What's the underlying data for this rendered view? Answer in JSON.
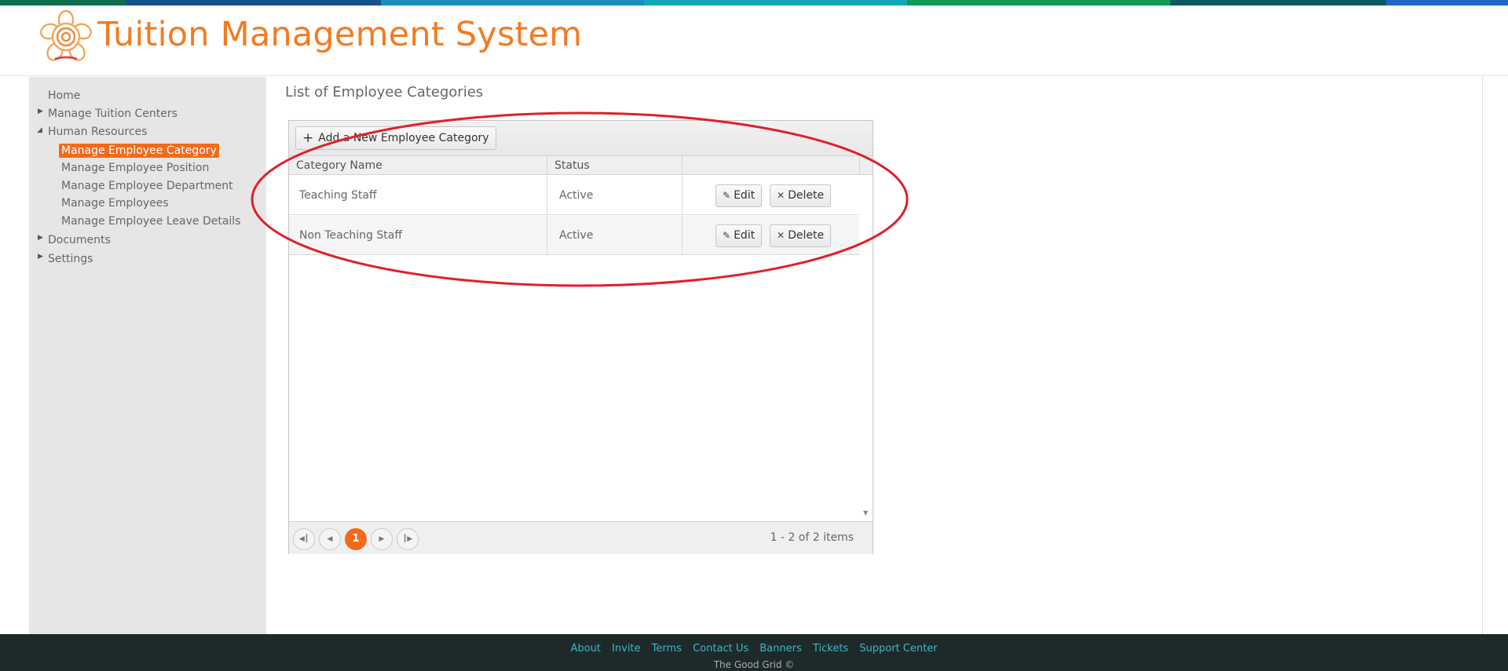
{
  "stripe_colors": [
    "#0c6e4f",
    "#15518f",
    "#1a8ebf",
    "#12a8b8",
    "#0f9a58",
    "#0c5960",
    "#1d69c0"
  ],
  "header": {
    "title": "Tuition Management System",
    "logo_icon": "flower-logo-icon"
  },
  "sidebar": {
    "items": [
      {
        "label": "Home"
      },
      {
        "label": "Manage Tuition Centers"
      },
      {
        "label": "Human Resources"
      },
      {
        "label": "Manage Employee Category"
      },
      {
        "label": "Manage Employee Position"
      },
      {
        "label": "Manage Employee Department"
      },
      {
        "label": "Manage Employees"
      },
      {
        "label": "Manage Employee Leave Details"
      },
      {
        "label": "Documents"
      },
      {
        "label": "Settings"
      }
    ]
  },
  "main": {
    "title": "List of Employee Categories",
    "add_button": "Add a New Employee Category",
    "columns": [
      "Category Name",
      "Status",
      ""
    ],
    "rows": [
      {
        "name": "Teaching Staff",
        "status": "Active"
      },
      {
        "name": "Non Teaching Staff",
        "status": "Active"
      }
    ],
    "edit_label": "Edit",
    "delete_label": "Delete",
    "pager": {
      "current": "1",
      "info": "1 - 2 of 2 items"
    }
  },
  "annotation_color": "#e0202a",
  "footer": {
    "links": [
      "About",
      "Invite",
      "Terms",
      "Contact Us",
      "Banners",
      "Tickets",
      "Support Center"
    ],
    "copyright": "The Good Grid ©"
  }
}
